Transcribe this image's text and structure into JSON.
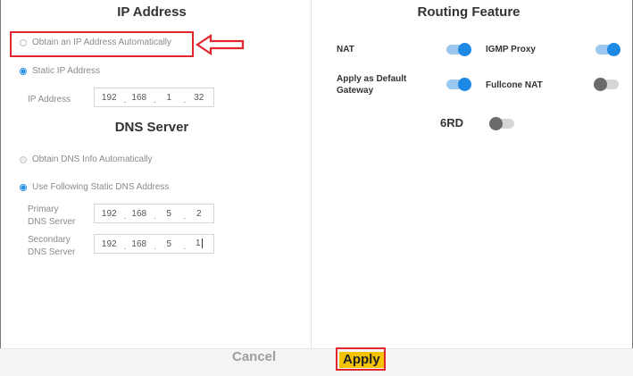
{
  "left": {
    "ip_section_title": "IP Address",
    "obtain_auto_label": "Obtain an IP Address Automatically",
    "static_ip_label": "Static IP Address",
    "ip_address_label": "IP Address",
    "ip_address": [
      "192",
      "168",
      "1",
      "32"
    ],
    "dns_section_title": "DNS Server",
    "dns_auto_label": "Obtain DNS Info Automatically",
    "dns_static_label": "Use Following Static DNS Address",
    "primary_dns_label": [
      "Primary",
      "DNS Server"
    ],
    "primary_dns": [
      "192",
      "168",
      "5",
      "2"
    ],
    "secondary_dns_label": [
      "Secondary",
      "DNS Server"
    ],
    "secondary_dns": [
      "192",
      "168",
      "5",
      "1"
    ]
  },
  "right": {
    "title": "Routing Feature",
    "nat_label": "NAT",
    "nat_on": true,
    "igmp_label": "IGMP Proxy",
    "igmp_on": true,
    "default_gw_label": [
      "Apply as Default",
      "Gateway"
    ],
    "default_gw_on": true,
    "fullcone_label": "Fullcone NAT",
    "fullcone_on": false,
    "sixrd_label": "6RD",
    "sixrd_on": false
  },
  "footer": {
    "cancel_label": "Cancel",
    "apply_label": "Apply"
  },
  "colors": {
    "accent": "#1e88e5",
    "annotation": "#e2262e",
    "apply_highlight": "#f3c200"
  }
}
